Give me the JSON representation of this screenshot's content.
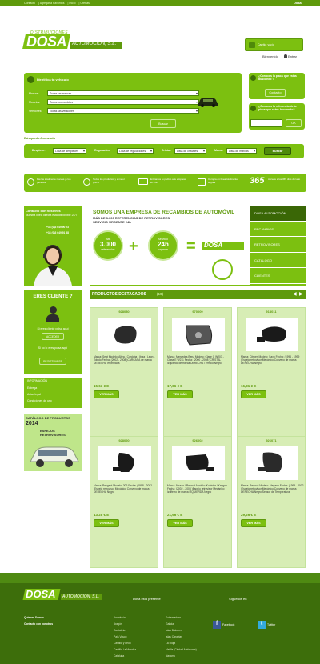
{
  "topbar": {
    "links": [
      "Contacto",
      "Agregar a Favoritos",
      "Inicio",
      "Ofertas"
    ],
    "right": "Dosa"
  },
  "header": {
    "logo_top": "DISTRIBUCIONES",
    "logo_main": "DOSA",
    "logo_sub": "AUTOMOCIÓN, S.L.",
    "cart_label": "Carrito: vacío",
    "welcome": "Bienvenido",
    "login": "Entrar"
  },
  "search": {
    "title": "Identifica tu vehículo",
    "fields": [
      {
        "label": "Marcas:",
        "value": "Todas las marcas"
      },
      {
        "label": "Modelos:",
        "value": "Todos los modelos"
      },
      {
        "label": "Versiones:",
        "value": "Todas las versiones"
      }
    ],
    "button": "Buscar"
  },
  "right_top": {
    "q1": "¿Conoces la placa que estas buscando ?",
    "q1_btn": "Contacto",
    "q2": "¿Conoces la referencia de la pieza que estas buscando?",
    "q2_btn": "OK"
  },
  "advanced": "Búsqueda Avanzada",
  "filters": [
    {
      "label": "Despiece:",
      "value": "Lista de despieces"
    },
    {
      "label": "Regulación:",
      "value": "Lista de regulaciones"
    },
    {
      "label": "Cristal:",
      "value": "Lista de cristales"
    },
    {
      "label": "Marca:",
      "value": "Lista de marcas"
    }
  ],
  "filters_btn": "Buscar",
  "features": [
    "Piezas totalmente nuevas y con garantía",
    "Todos los productos y a mejor precio",
    "Enviamos tu pedido a tu empresa en 24h",
    "Compra en línea totalmente segura",
    "Accede a los 365 días del año"
  ],
  "features_number": "365",
  "contact": {
    "title": "Contacto con nosotros",
    "line2": "Nuestra línea directa está disponible 24/7",
    "phones": [
      "+34 (0)3 649 90 23",
      "+34 (0)3 649 91 38"
    ]
  },
  "banner": {
    "title": "SOMOS UNA EMPRESA DE RECAMBIOS DE AUTOMÓVIL",
    "sub1": "MÁS DE 3.000 REFERENCIAS DE RETROVISORES",
    "sub2": "SERVICIO URGENTE 24h",
    "c1_top": "más",
    "c1_mid": "3.000",
    "c1_bot": "referencias",
    "c2_top": "servicio",
    "c2_mid": "24h",
    "c2_bot": "urgente",
    "logo": "DOSA"
  },
  "banner_menu": [
    "DOSA AUTOMOCIÓN",
    "RECAMBIOS",
    "RETROVISORES",
    "CATÁLOGO",
    "CLIENTES",
    "CONTACTO"
  ],
  "eres": {
    "title": "ERES CLIENTE ?",
    "line1": "Si eres cliente pulsa aquí",
    "btn1": "ACCEDER",
    "line2": "Si no lo eres pulsa aquí",
    "btn2": "REGISTRARSE"
  },
  "cat": {
    "title": "INFORMACIÓN",
    "items": [
      "Entrega",
      "Aviso legal",
      "Condiciones de uso"
    ]
  },
  "catalog": {
    "title": "CATÁLOGO DE PRODUCTOS",
    "year": "2014",
    "sub": "ESPEJOS RETROVISORES"
  },
  "products_header": "PRODUCTOS DESTACADOS",
  "products_count": "(10)",
  "products": [
    {
      "ref": "928030",
      "desc": "Marca: Seat Modelo: Altea - Cordoba - Ibiza - Leon - Toledo Fecha: (2002 - 2008 )CARCASA de marca DERECHA Imprimada",
      "price": "15,63 € E",
      "btn": "VER MÁS"
    },
    {
      "ref": "970009",
      "desc": "Marca: Mercedes Benz Modelo: Clase C W203 - Clase E W211 Fecha: (2000 - 2008 )CRISTAL Izquierdo de marca DERECHA Térmico Negro",
      "price": "17,86 € E",
      "btn": "VER MÁS"
    },
    {
      "ref": "918011",
      "desc": "Marca: Citroen Modelo: Saxo Fecha: (1996 - 1999 )Espejo retrovisor Mecánico Convexo de marca DERECHA Negro",
      "price": "16,81 € E",
      "btn": "VER MÁS"
    },
    {
      "ref": "928020",
      "desc": "Marca: Peugeot Modelo: 306 Fecha: (1998 - 2002 )Espejo retrovisor Mecánico Convexo de marca DERECHA Negro",
      "price": "13,28 € E",
      "btn": "VER MÁS"
    },
    {
      "ref": "926002",
      "desc": "Marca: Nissan / Renault Modelo: Kubistar / Kangoo Fecha: (2002 - 2008 )Espejo retrovisor Mecánico Izdiferro de marca IZQUIERDA Negro",
      "price": "21,66 € E",
      "btn": "VER MÁS"
    },
    {
      "ref": "926071",
      "desc": "Marca: Renault Modelo: Megane Fecha: (1999 - 2002 )Espejo retrovisor Mecánico Convexo de marca DERECHA Negro Sensor de Temperatura",
      "price": "29,26 € E",
      "btn": "VER MÁS"
    }
  ],
  "footer": {
    "logo_main": "DOSA",
    "logo_sub": "AUTOMOCIÓN, S.L.",
    "present": "Dosa está presente",
    "follow": "Síguenos en",
    "links": [
      "Quienes Somos",
      "Contacto con nosotros"
    ],
    "col1": [
      "Andalucía",
      "Aragón",
      "Cantabria",
      "País Vasco",
      "Castilla y León",
      "Castilla La Mancha",
      "Cataluña"
    ],
    "col2": [
      "Extremadura",
      "Galicia",
      "Islas Baleares",
      "Islas Canarias",
      "La Rioja",
      "Melilla (Ciudad Autónoma)",
      "Navarra"
    ],
    "facebook": "Facebook",
    "twitter": "Twitter"
  },
  "colors": {
    "green": "#7cc010",
    "dark_green": "#5f9a0c",
    "footer": "#3d6e0b"
  }
}
